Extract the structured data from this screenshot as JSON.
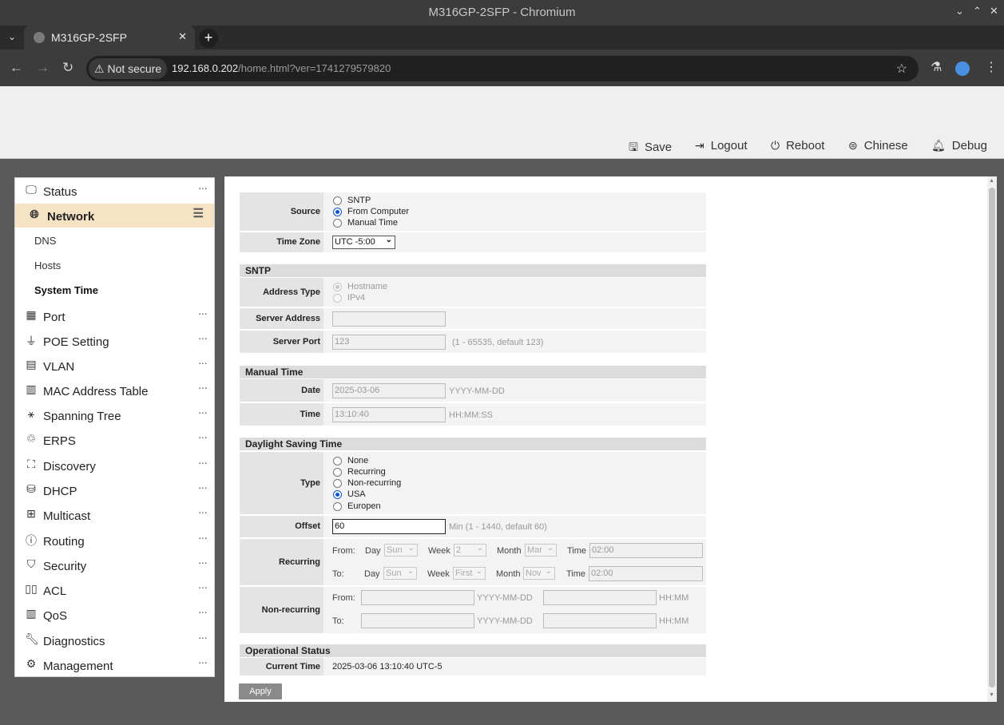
{
  "window": {
    "title": "M316GP-2SFP - Chromium"
  },
  "tab": {
    "title": "M316GP-2SFP"
  },
  "address_bar": {
    "security": "Not secure",
    "host": "192.168.0.202",
    "path": "/home.html?ver=1741279579820"
  },
  "header": {
    "save": "Save",
    "logout": "Logout",
    "reboot": "Reboot",
    "chinese": "Chinese",
    "debug": "Debug"
  },
  "sidebar": {
    "items": [
      {
        "label": "Status",
        "icon": "monitor-icon"
      },
      {
        "label": "Network",
        "icon": "globe-icon"
      },
      {
        "label": "Port",
        "icon": "port-icon"
      },
      {
        "label": "POE Setting",
        "icon": "plug-icon"
      },
      {
        "label": "VLAN",
        "icon": "list-icon"
      },
      {
        "label": "MAC Address Table",
        "icon": "table-icon"
      },
      {
        "label": "Spanning Tree",
        "icon": "tree-icon"
      },
      {
        "label": "ERPS",
        "icon": "ring-icon"
      },
      {
        "label": "Discovery",
        "icon": "sitemap-icon"
      },
      {
        "label": "DHCP",
        "icon": "database-icon"
      },
      {
        "label": "Multicast",
        "icon": "multicast-icon"
      },
      {
        "label": "Routing",
        "icon": "ip-icon"
      },
      {
        "label": "Security",
        "icon": "shield-icon"
      },
      {
        "label": "ACL",
        "icon": "acl-icon"
      },
      {
        "label": "QoS",
        "icon": "qos-icon"
      },
      {
        "label": "Diagnostics",
        "icon": "wrench-icon"
      },
      {
        "label": "Management",
        "icon": "gear-icon"
      }
    ],
    "network_sub": [
      "DNS",
      "Hosts",
      "System Time"
    ],
    "active_item": "Network",
    "active_sub": "System Time"
  },
  "form": {
    "source": {
      "label": "Source",
      "options": [
        "SNTP",
        "From Computer",
        "Manual Time"
      ],
      "selected": "From Computer"
    },
    "time_zone": {
      "label": "Time Zone",
      "value": "UTC -5:00"
    },
    "sntp": {
      "heading": "SNTP",
      "address_type": {
        "label": "Address Type",
        "options": [
          "Hostname",
          "IPv4"
        ],
        "selected": "Hostname"
      },
      "server_address": {
        "label": "Server Address",
        "value": ""
      },
      "server_port": {
        "label": "Server Port",
        "value": "123",
        "hint": "(1 - 65535, default 123)"
      }
    },
    "manual_time": {
      "heading": "Manual Time",
      "date": {
        "label": "Date",
        "value": "2025-03-06",
        "hint": "YYYY-MM-DD"
      },
      "time": {
        "label": "Time",
        "value": "13:10:40",
        "hint": "HH:MM:SS"
      }
    },
    "dst": {
      "heading": "Daylight Saving Time",
      "type": {
        "label": "Type",
        "options": [
          "None",
          "Recurring",
          "Non-recurring",
          "USA",
          "Europen"
        ],
        "selected": "USA"
      },
      "offset": {
        "label": "Offset",
        "value": "60",
        "hint": "Min (1 - 1440, default 60)"
      },
      "recurring": {
        "label": "Recurring",
        "from_label": "From:",
        "to_label": "To:",
        "day_label": "Day",
        "week_label": "Week",
        "month_label": "Month",
        "time_label": "Time",
        "from": {
          "day": "Sun",
          "week": "2",
          "month": "Mar",
          "time": "02:00"
        },
        "to": {
          "day": "Sun",
          "week": "First",
          "month": "Nov",
          "time": "02:00"
        }
      },
      "non_recurring": {
        "label": "Non-recurring",
        "from_label": "From:",
        "to_label": "To:",
        "date_hint": "YYYY-MM-DD",
        "time_hint": "HH:MM"
      }
    },
    "operational": {
      "heading": "Operational Status",
      "current_time": {
        "label": "Current Time",
        "value": "2025-03-06 13:10:40 UTC-5"
      }
    },
    "apply": "Apply"
  }
}
